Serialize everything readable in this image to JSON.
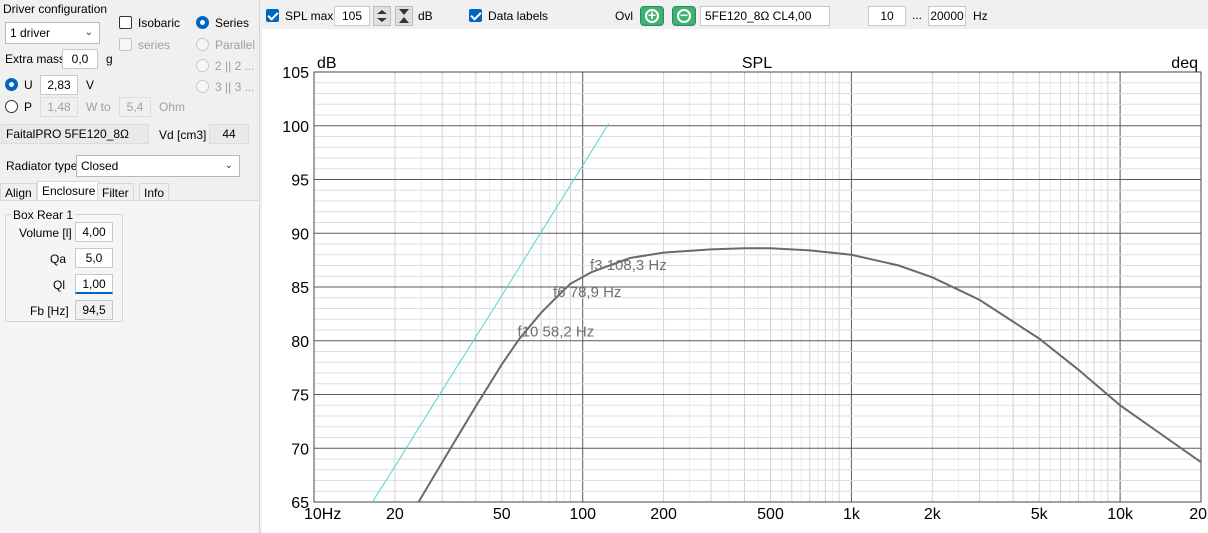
{
  "left_panel": {
    "driver_config_title": "Driver configuration",
    "driver_count": "1 driver",
    "isobaric_label": "Isobaric",
    "series_label": "series",
    "series_radio_label": "Series",
    "parallel_label": "Parallel",
    "opt_2_label": "2 || 2 ...",
    "opt_3_label": "3 || 3 ...",
    "extra_mass_label": "Extra mass",
    "extra_mass_value": "0,0",
    "extra_mass_unit": "g",
    "u_label": "U",
    "u_value": "2,83",
    "u_unit": "V",
    "p_label": "P",
    "p_value": "1,48",
    "w_to_label": "W to",
    "ohm_value": "5,4",
    "ohm_unit": "Ohm",
    "driver_name": "FaitalPRO 5FE120_8Ω",
    "vd_label": "Vd [cm3]",
    "vd_value": "44",
    "radiator_type_label": "Radiator type",
    "radiator_type_value": "Closed",
    "tabs": [
      "Align",
      "Enclosure",
      "Filter",
      "Info"
    ],
    "box_title": "Box Rear 1",
    "volume_label": "Volume [l]",
    "volume_value": "4,00",
    "qa_label": "Qa",
    "qa_value": "5,0",
    "ql_label": "Ql",
    "ql_value": "1,00",
    "fb_label": "Fb [Hz]",
    "fb_value": "94,5"
  },
  "toolbar": {
    "spl_max_label": "SPL max",
    "spl_max_value": "105",
    "spl_unit": "dB",
    "data_labels_label": "Data labels",
    "ovl_label": "Ovl",
    "curve_name": "5FE120_8Ω CL4,00",
    "f_min": "10",
    "range_sep": "...",
    "f_max": "20000",
    "f_unit": "Hz"
  },
  "chart_data": {
    "type": "line",
    "title": "SPL",
    "ylabel": "dB",
    "y2label": "deq",
    "x_scale": "log",
    "xlim": [
      10,
      20000
    ],
    "ylim": [
      65,
      105
    ],
    "grid": true,
    "x_tick_labels": [
      "10Hz",
      "20",
      "50",
      "100",
      "200",
      "500",
      "1k",
      "2k",
      "5k",
      "10k",
      "20"
    ],
    "y_tick_labels": [
      "65",
      "70",
      "75",
      "80",
      "85",
      "90",
      "95",
      "100",
      "105"
    ],
    "series": [
      {
        "color": "#6a6a6a",
        "x": [
          24.5,
          30,
          40,
          50,
          58.2,
          70,
          78.9,
          90,
          108.3,
          150,
          200,
          300,
          400,
          500,
          700,
          1000,
          1500,
          2000,
          3000,
          5000,
          7000,
          10000,
          15000,
          20000
        ],
        "y": [
          65,
          68.7,
          73.9,
          77.8,
          80.2,
          82.6,
          83.9,
          85.3,
          86.4,
          87.7,
          88.2,
          88.5,
          88.6,
          88.6,
          88.4,
          88.0,
          87.0,
          85.9,
          83.8,
          80.2,
          77.3,
          74.0,
          70.9,
          68.7
        ]
      },
      {
        "color": "#4fd6d6",
        "x": [
          16.5,
          20,
          30,
          50,
          70,
          100,
          125
        ],
        "y": [
          65,
          68.3,
          75.4,
          84.2,
          90.1,
          96.3,
          100.2
        ]
      }
    ],
    "annotations": [
      {
        "text": "f3 108,3 Hz",
        "x": 108.3,
        "y": 86.4
      },
      {
        "text": "f6 78,9 Hz",
        "x": 78.9,
        "y": 83.9
      },
      {
        "text": "f10 58,2 Hz",
        "x": 58.2,
        "y": 80.2
      }
    ]
  }
}
